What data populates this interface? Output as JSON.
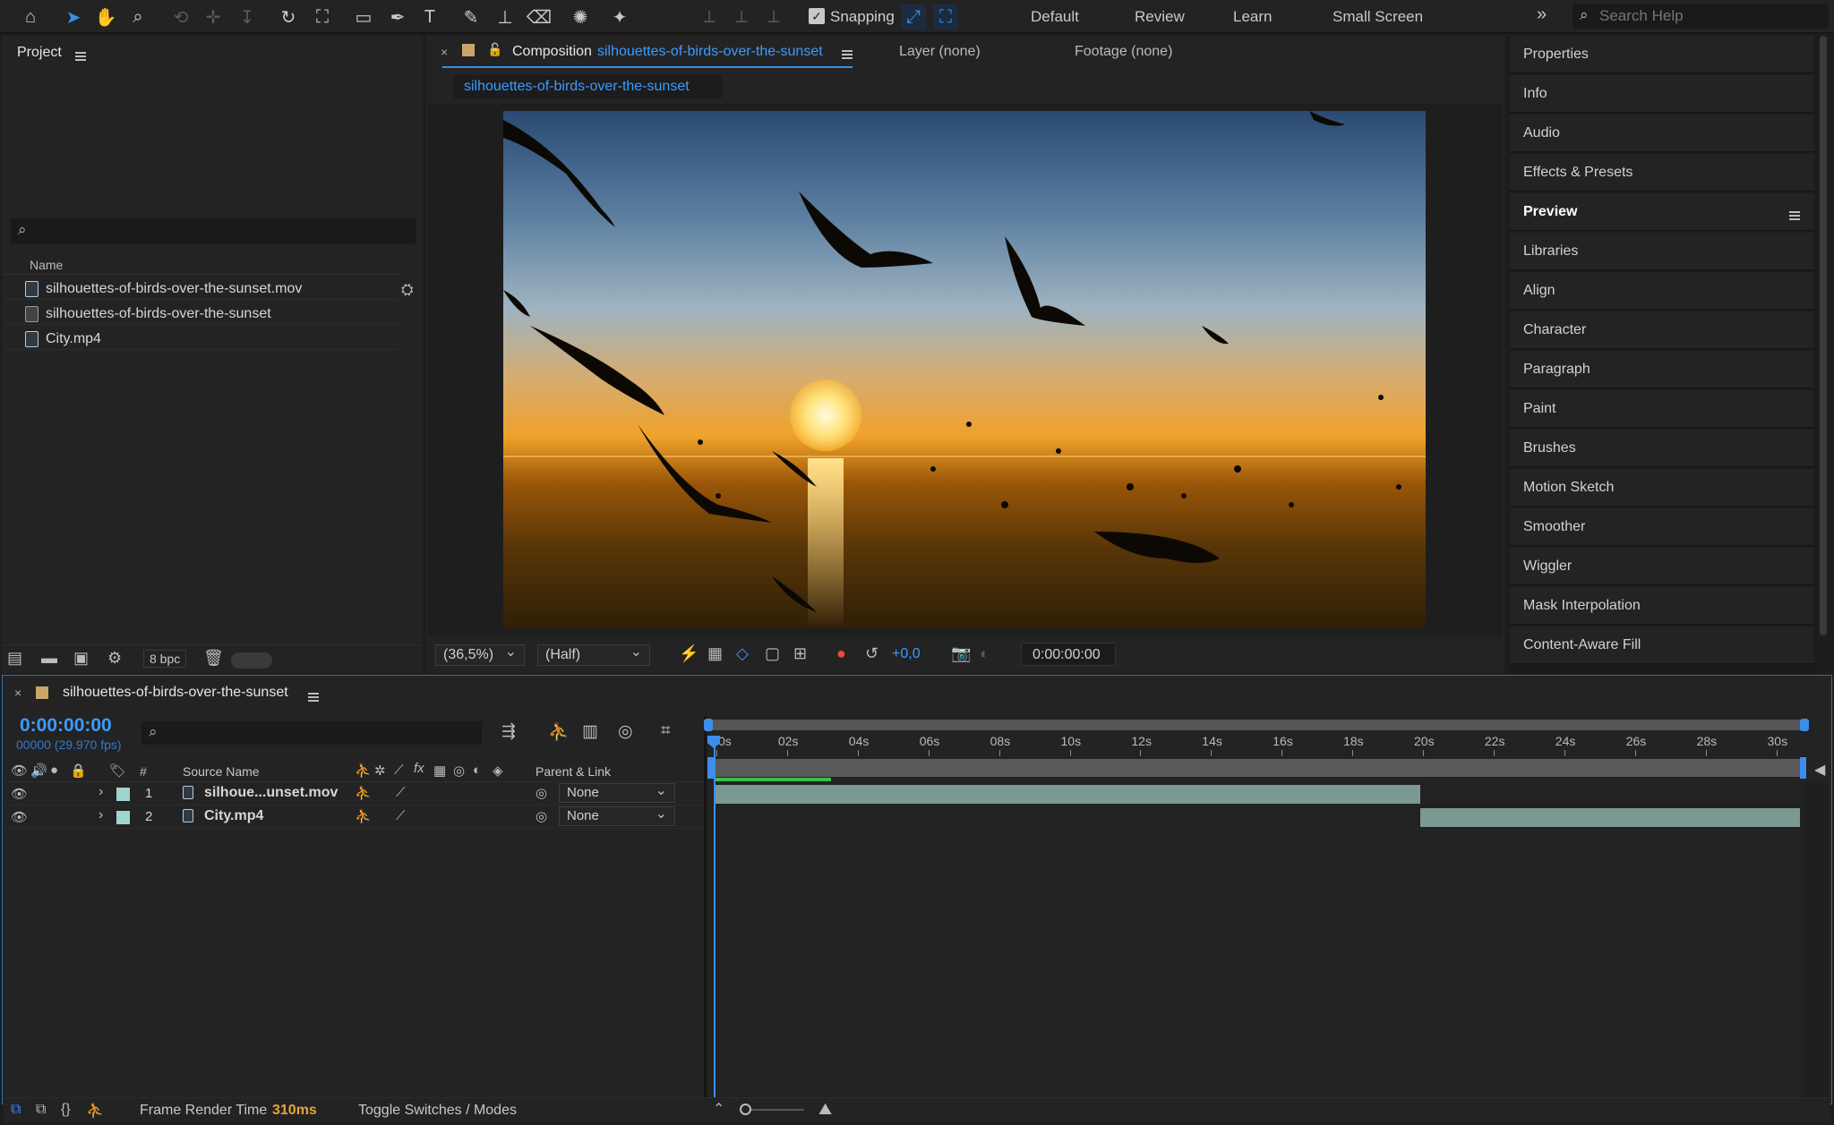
{
  "toolbar": {
    "snapping_label": "Snapping",
    "workspaces": [
      "Default",
      "Review",
      "Learn",
      "Small Screen"
    ],
    "search_placeholder": "Search Help"
  },
  "project": {
    "title": "Project",
    "column_name": "Name",
    "items": [
      "silhouettes-of-birds-over-the-sunset.mov",
      "silhouettes-of-birds-over-the-sunset",
      "City.mp4"
    ],
    "bpc": "8 bpc"
  },
  "composition": {
    "tab_prefix": "Composition",
    "tab_name": "silhouettes-of-birds-over-the-sunset",
    "layer_tab": "Layer (none)",
    "footage_tab": "Footage (none)",
    "breadcrumb": "silhouettes-of-birds-over-the-sunset",
    "zoom": "(36,5%)",
    "resolution": "(Half)",
    "exposure": "+0,0",
    "timecode": "0:00:00:00"
  },
  "right_panel": {
    "items": [
      "Properties",
      "Info",
      "Audio",
      "Effects & Presets",
      "Preview",
      "Libraries",
      "Align",
      "Character",
      "Paragraph",
      "Paint",
      "Brushes",
      "Motion Sketch",
      "Smoother",
      "Wiggler",
      "Mask Interpolation",
      "Content-Aware Fill"
    ]
  },
  "timeline": {
    "comp_name": "silhouettes-of-birds-over-the-sunset",
    "timecode": "0:00:00:00",
    "frame_info": "00000 (29.970 fps)",
    "col_hash": "#",
    "col_source": "Source Name",
    "col_parent": "Parent & Link",
    "ticks": [
      "0s",
      "02s",
      "04s",
      "06s",
      "08s",
      "10s",
      "12s",
      "14s",
      "16s",
      "18s",
      "20s",
      "22s",
      "24s",
      "26s",
      "28s",
      "30s"
    ],
    "layers": [
      {
        "num": "1",
        "name": "silhoue...unset.mov",
        "parent": "None"
      },
      {
        "num": "2",
        "name": "City.mp4",
        "parent": "None"
      }
    ],
    "render_label": "Frame Render Time",
    "render_value": "310ms",
    "toggle_label": "Toggle Switches / Modes"
  },
  "colors": {
    "accent": "#3b8eea",
    "orange": "#e8a33a",
    "layer_bar": "#7c9893",
    "work_area": "#36c24a"
  }
}
